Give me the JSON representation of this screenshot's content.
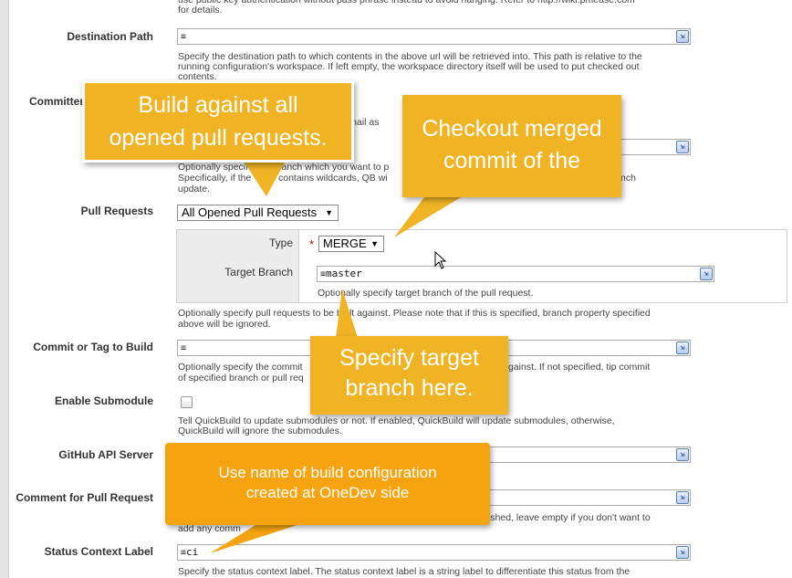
{
  "help_top": "use public key authentication without pass phrase instead to avoid hanging. Refer to http://wiki.pmease.com\nfor details.",
  "destination": {
    "label": "Destination Path",
    "value": "",
    "help": "Specify the destination path to which contents in the above url will be retrieved into. This path is relative to the\nrunning configuration's workspace. If left empty, the workspace directory itself will be used to put checked out\ncontents."
  },
  "committer": {
    "label": "Committer",
    "help_fragment": "r email as"
  },
  "branch": {
    "value": "",
    "help_line1_a": "Optionally specif",
    "help_line1_b": "ranch which you want to p",
    "help_line2_a": "Specifically, if the",
    "help_line2_b": "contains wildcards, QB wi",
    "help_line2_c": "nch",
    "help_line3": "update."
  },
  "pull_requests": {
    "label": "Pull Requests",
    "selected": "All Opened Pull Requests",
    "type_label": "Type",
    "required_marker": "*",
    "type_selected": "MERGE",
    "target_branch_label": "Target Branch",
    "target_branch_value": "master",
    "target_branch_help": "Optionally specify target branch of the pull request.",
    "help_line1": "Optionally specify pull requests to be built against. Please note that if this is specified, branch property specified",
    "help_line2": "above will be ignored."
  },
  "commit_tag": {
    "label": "Commit or Tag to Build",
    "value": "",
    "help_line1_a": "Optionally specify the commit",
    "help_line1_b": "gainst. If not specified, tip commit",
    "help_line2": "of specified branch or pull req"
  },
  "submodule": {
    "label": "Enable Submodule",
    "help": "Tell QuickBuild to update submodules or not. If enabled, QuickBuild will update submodules, otherwise,\nQuickBuild will ignore the submodules."
  },
  "github_api": {
    "label": "GitHub API Server",
    "value": ""
  },
  "comment_pr": {
    "label": "Comment for Pull Request",
    "value": "",
    "help_line1_b": "ished, leave empty if you don't want to",
    "help_line2": "add any comm"
  },
  "status_context": {
    "label": "Status Context Label",
    "value": "ci",
    "help": "Specify the status context label. The status context label is a string label to differentiate this status from the"
  },
  "callouts": {
    "all_opened": "Build against all\nopened pull requests.",
    "merged": "Checkout merged\ncommit of the",
    "target": "Specify target\nbranch here.",
    "build_config": "Use name of build configuration\ncreated at OneDev side"
  },
  "icons": {
    "field_prefix": "≡",
    "expand": "expand-editor-icon",
    "dropdown": "▼"
  },
  "colors": {
    "callout_yellow": "#f0b323",
    "callout_orange": "#f5a40f"
  }
}
